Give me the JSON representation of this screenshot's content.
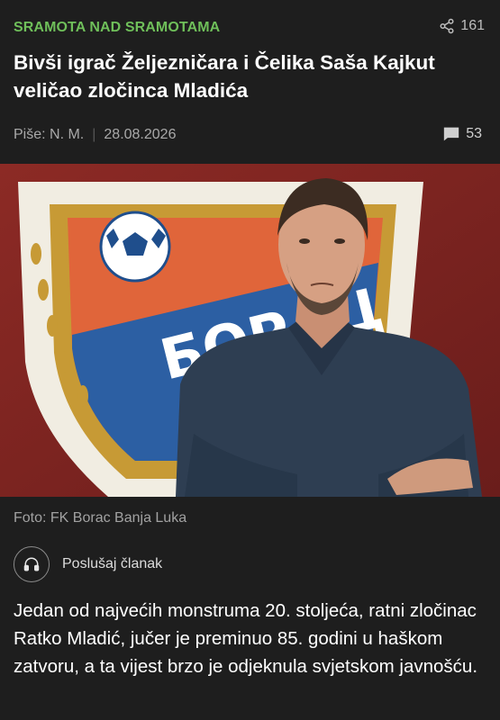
{
  "article": {
    "category": "SRAMOTA NAD SRAMOTAMA",
    "share_count": "161",
    "title": "Bivši igrač Željezničara i Čelika Saša Kajkut veličao zločinca Mladića",
    "author": "Piše: N. M.",
    "date": "28.08.2026",
    "comment_count": "53",
    "photo_caption": "Foto: FK Borac Banja Luka",
    "listen_label": "Poslušaj članak",
    "lead": "Jedan od najvećih monstruma 20. stoljeća, ratni zločinac Ratko Mladić, jučer je preminuo 85. godini u haškom zatvoru, a ta vijest brzo je odjeknula svjetskom javnošću."
  },
  "photo": {
    "crest_text": "БОРАЦ"
  },
  "icons": {
    "share": "share-icon",
    "comments": "comment-icon",
    "listen": "headphones-icon"
  },
  "colors": {
    "background": "#1e1e1e",
    "category": "#6fbf5a",
    "text": "#ffffff",
    "muted": "#a9a9a9"
  }
}
